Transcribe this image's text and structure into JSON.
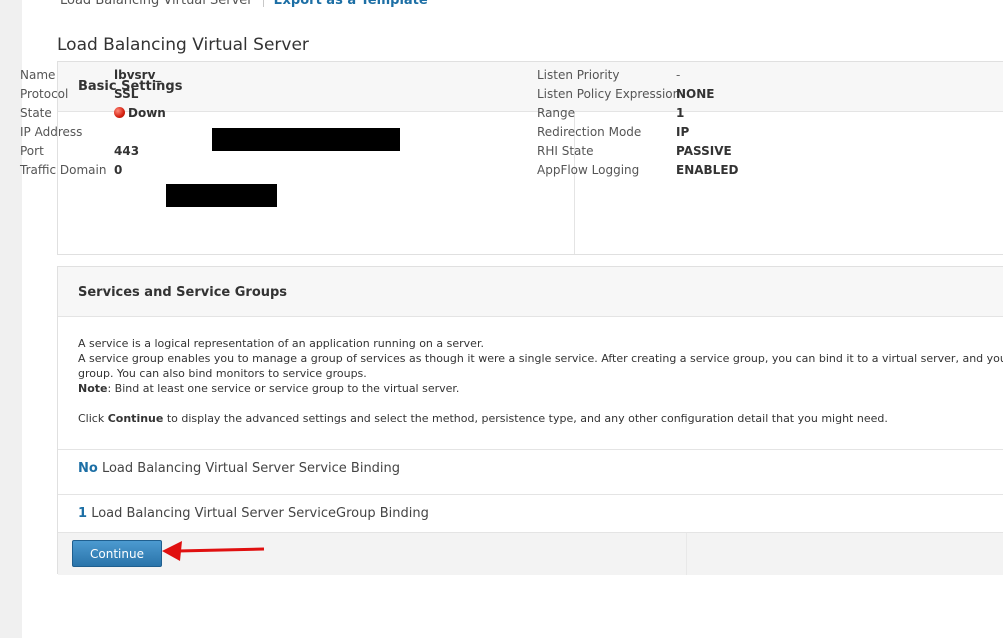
{
  "breadcrumb": {
    "current": "Load Balancing Virtual Server",
    "link": "Export as a Template"
  },
  "page_title": "Load Balancing Virtual Server",
  "basic_settings": {
    "title": "Basic Settings",
    "left": [
      {
        "label": "Name",
        "value": "lbvsrv_"
      },
      {
        "label": "Protocol",
        "value": "SSL"
      },
      {
        "label": "State",
        "value": "Down",
        "status_color": "#d42010"
      },
      {
        "label": "IP Address",
        "value": ""
      },
      {
        "label": "Port",
        "value": "443"
      },
      {
        "label": "Traffic Domain",
        "value": "0"
      }
    ],
    "right": [
      {
        "label": "Listen Priority",
        "value": "-"
      },
      {
        "label": "Listen Policy Expression",
        "value": "NONE"
      },
      {
        "label": "Range",
        "value": "1"
      },
      {
        "label": "Redirection Mode",
        "value": "IP"
      },
      {
        "label": "RHI State",
        "value": "PASSIVE"
      },
      {
        "label": "AppFlow Logging",
        "value": "ENABLED"
      }
    ]
  },
  "services": {
    "title": "Services and Service Groups",
    "line1": "A service is a logical representation of an application running on a server.",
    "line2": "A service group enables you to manage a group of services as though it were a single service. After creating a service group, you can bind it to a virtual server, and you can add s",
    "line3": "group. You can also bind monitors to service groups.",
    "note_label": "Note",
    "note_text": ": Bind at least one service or service group to the virtual server.",
    "click_pre": "Click ",
    "click_bold": "Continue",
    "click_post": " to display the advanced settings and select the method, persistence type, and any other configuration detail that you might need.",
    "binding_service": {
      "count": "No",
      "label": "Load Balancing Virtual Server Service Binding"
    },
    "binding_group": {
      "count": "1",
      "label": "Load Balancing Virtual Server ServiceGroup Binding"
    },
    "continue_label": "Continue"
  },
  "colors": {
    "accent": "#1d6fa5",
    "button": "#2a74aa",
    "arrow": "#e01010"
  }
}
